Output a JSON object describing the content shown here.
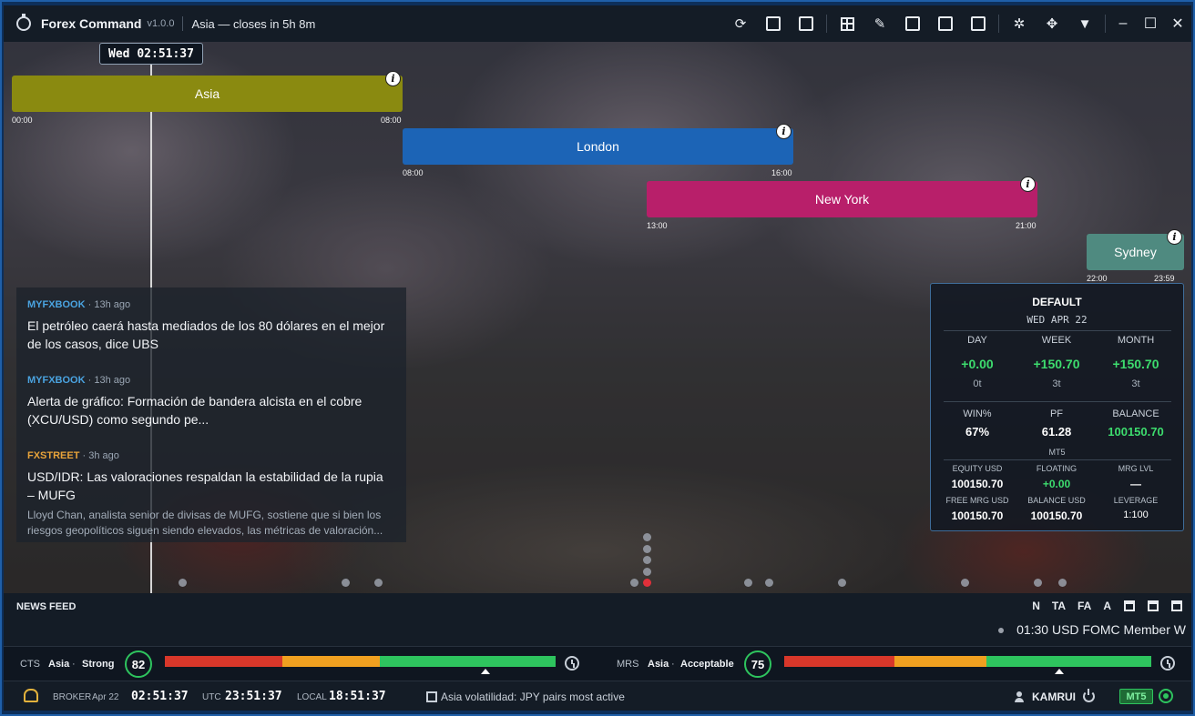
{
  "app": {
    "name": "Forex Command",
    "version": "v1.0.0",
    "session_status": "Asia  —  closes in 5h 8m"
  },
  "now_marker": "Wed 02:51:37",
  "sessions": [
    {
      "name": "Asia",
      "start": "00:00",
      "end": "08:00",
      "color": "#8a8a10"
    },
    {
      "name": "London",
      "start": "08:00",
      "end": "16:00",
      "color": "#1c64b6"
    },
    {
      "name": "New York",
      "start": "13:00",
      "end": "21:00",
      "color": "#b81f6a"
    },
    {
      "name": "Sydney",
      "start": "22:00",
      "end": "23:59",
      "color": "#4f8a80"
    }
  ],
  "news": [
    {
      "source": "MYFXBOOK",
      "age": " · 13h ago",
      "source_color": "#4aa3e0",
      "title": "El petróleo caerá hasta mediados de los 80 dólares en el mejor de los casos, dice UBS",
      "desc": ""
    },
    {
      "source": "MYFXBOOK",
      "age": " · 13h ago",
      "source_color": "#4aa3e0",
      "title": "Alerta de gráfico: Formación de bandera alcista en el cobre (XCU/USD) como segundo pe...",
      "desc": ""
    },
    {
      "source": "FXSTREET",
      "age": " · 3h ago",
      "source_color": "#e8a33a",
      "title": "USD/IDR: Las valoraciones respaldan la estabilidad de la rupia – MUFG",
      "desc": "Lloyd Chan, analista senior de divisas de MUFG, sostiene que si bien los riesgos geopolíticos siguen siendo elevados, las métricas de valoración..."
    }
  ],
  "account": {
    "title": "DEFAULT",
    "date": "WED APR 22",
    "periods": [
      {
        "label": "DAY",
        "value": "+0.00",
        "trades": "0t"
      },
      {
        "label": "WEEK",
        "value": "+150.70",
        "trades": "3t"
      },
      {
        "label": "MONTH",
        "value": "+150.70",
        "trades": "3t"
      }
    ],
    "stats": [
      {
        "label": "WIN%",
        "value": "67%"
      },
      {
        "label": "PF",
        "value": "61.28"
      },
      {
        "label": "BALANCE",
        "value": "100150.70"
      }
    ],
    "platform": "MT5",
    "details": [
      {
        "label": "EQUITY USD",
        "value": "100150.70"
      },
      {
        "label": "FLOATING",
        "value": "+0.00"
      },
      {
        "label": "MRG LVL",
        "value": "—"
      },
      {
        "label": "FREE MRG USD",
        "value": "100150.70"
      },
      {
        "label": "BALANCE USD",
        "value": "100150.70"
      },
      {
        "label": "LEVERAGE",
        "value": "1:100"
      }
    ]
  },
  "news_feed": {
    "label": "NEWS FEED",
    "tabs": [
      "N",
      "TA",
      "FA",
      "A"
    ],
    "ticker": "01:30  USD  FOMC Member W"
  },
  "cts": {
    "label": "CTS",
    "session": "Asia",
    "sep": "·",
    "state": "Strong",
    "score": "82",
    "pointer_pct": 82
  },
  "mrs": {
    "label": "MRS",
    "session": "Asia",
    "sep": "·",
    "state": "Acceptable",
    "score": "75",
    "pointer_pct": 75
  },
  "status": {
    "broker_label": "BROKER",
    "broker_date": "Apr 22",
    "broker_time": "02:51:37",
    "utc_label": "UTC",
    "utc_time": "23:51:37",
    "local_label": "LOCAL",
    "local_time": "18:51:37",
    "message": "Asia volatilidad: JPY pairs most active",
    "user": "KAMRUI",
    "platform": "MT5"
  },
  "colors": {
    "positive": "#3ddc6e",
    "meter_red": "#d8372a",
    "meter_orange": "#f0a020",
    "meter_green": "#2ec45e",
    "accent_border": "#1f5fa8"
  }
}
